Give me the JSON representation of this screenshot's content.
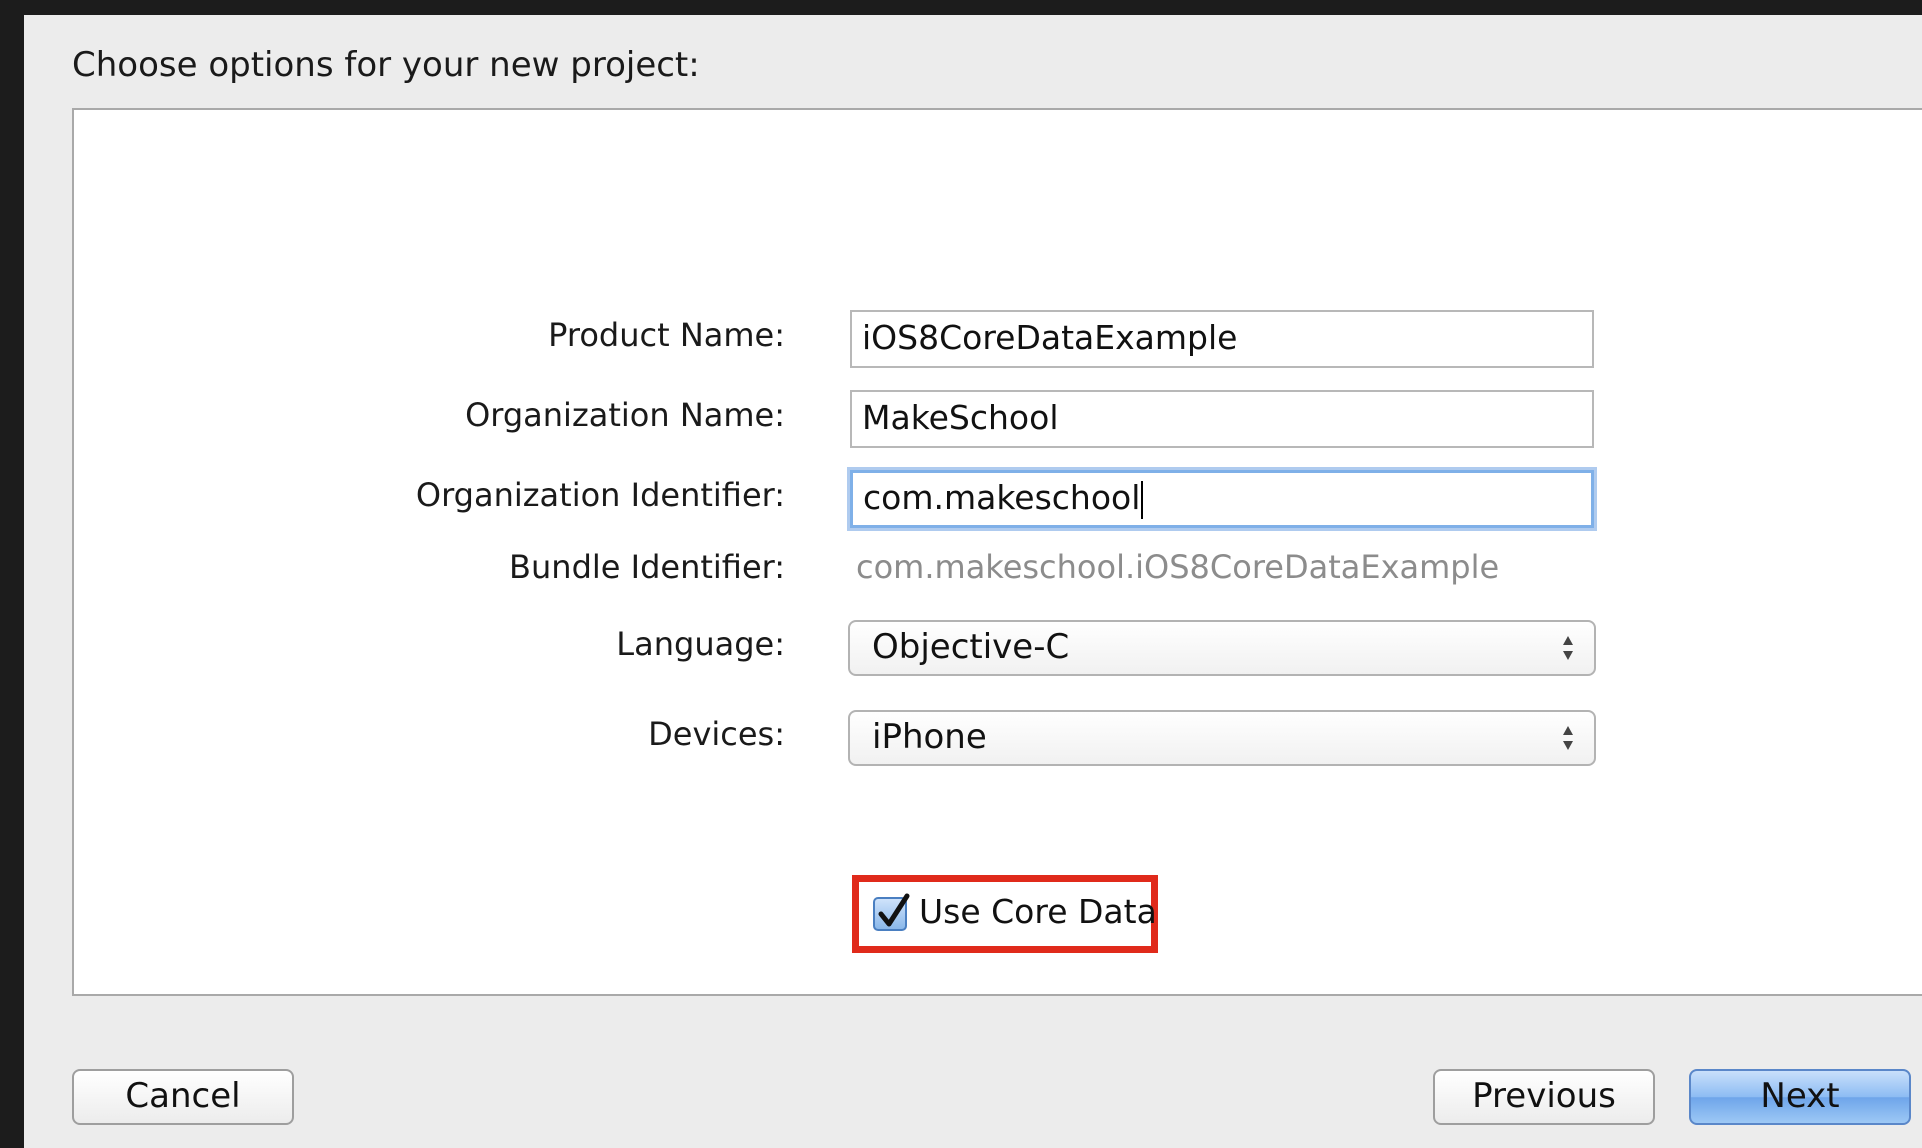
{
  "dialog": {
    "heading": "Choose options for your new project:"
  },
  "form": {
    "product_name": {
      "label": "Product Name:",
      "value": "iOS8CoreDataExample"
    },
    "organization_name": {
      "label": "Organization Name:",
      "value": "MakeSchool"
    },
    "organization_identifier": {
      "label": "Organization Identifier:",
      "value": "com.makeschool"
    },
    "bundle_identifier": {
      "label": "Bundle Identifier:",
      "value": "com.makeschool.iOS8CoreDataExample"
    },
    "language": {
      "label": "Language:",
      "selected": "Objective-C"
    },
    "devices": {
      "label": "Devices:",
      "selected": "iPhone"
    },
    "use_core_data": {
      "label": "Use Core Data",
      "checked": true
    }
  },
  "buttons": {
    "cancel": "Cancel",
    "previous": "Previous",
    "next": "Next"
  },
  "colors": {
    "highlight_box": "#e02a1b",
    "focus_ring": "#7fb0e8",
    "primary_button": "#8dbcf3"
  }
}
